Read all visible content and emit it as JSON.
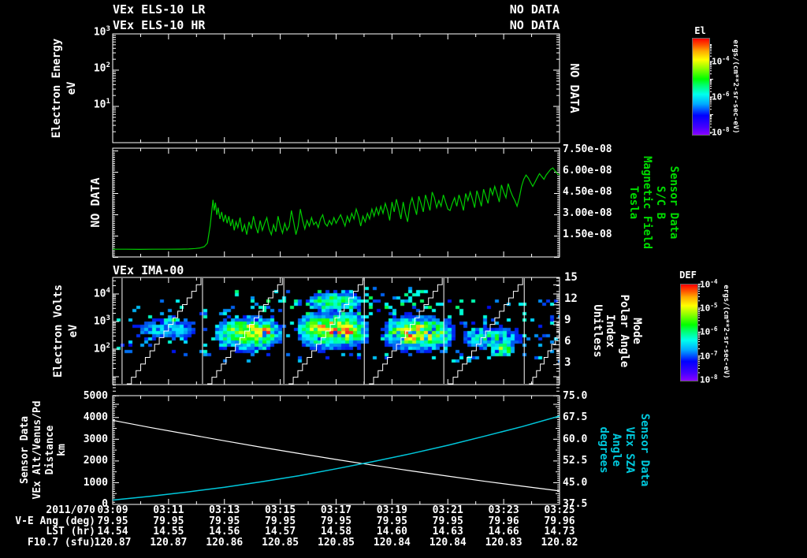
{
  "window": {
    "bg": "#000000",
    "fg": "#ffffff",
    "accent_green": "#00dd00",
    "accent_cyan": "#00c8dc"
  },
  "panel_els": {
    "title_lr": "VEx ELS-10 LR",
    "title_hr": "VEx ELS-10 HR",
    "no_data_lr": "NO DATA",
    "no_data_hr": "NO DATA",
    "no_data_overlay": "NO DATA",
    "ylabel": "Electron Energy",
    "ylabel_unit": "eV",
    "ytick_exps": [
      "3",
      "2",
      "1"
    ],
    "colorbar": {
      "title": "El",
      "tick_exps": [
        "-4",
        "-6",
        "-8"
      ],
      "unit": "ergs/(cm**2-sr-sec-eV)"
    }
  },
  "panel_mag": {
    "no_data": "NO DATA",
    "ytick_labels": [
      "7.50e-08",
      "6.00e-08",
      "4.50e-08",
      "3.00e-08",
      "1.50e-08"
    ],
    "right_labels": [
      "Tesla",
      "Magnetic Field",
      "S/C B",
      "Sensor Data"
    ]
  },
  "panel_ima": {
    "title": "VEx IMA-00",
    "ylabel": "Electron Volts",
    "ylabel_unit": "eV",
    "ytick_exps": [
      "4",
      "3",
      "2"
    ],
    "right_ticks": [
      "15",
      "12",
      "9",
      "6",
      "3"
    ],
    "right_labels": [
      "Unitless",
      "Index",
      "Polar Angle",
      "Mode"
    ],
    "colorbar": {
      "title": "DEF",
      "tick_exps": [
        "-4",
        "-5",
        "-6",
        "-7",
        "-8"
      ],
      "unit": "ergs/(cm**2-sr-sec-eV)"
    }
  },
  "panel_eph": {
    "left_labels": [
      "Sensor Data",
      "VEx Alt/Venus/Pd",
      "Distance",
      "km"
    ],
    "left_ticks": [
      "5000",
      "4000",
      "3000",
      "2000",
      "1000",
      "0"
    ],
    "right_ticks": [
      "75.0",
      "67.5",
      "60.0",
      "52.5",
      "45.0",
      "37.5"
    ],
    "right_labels": [
      "degrees",
      "Angle",
      "VEx SZA",
      "Sensor Data"
    ]
  },
  "table": {
    "row_labels": [
      "2011/070",
      "V-E Ang (deg)",
      "LST (hr)",
      "F10.7 (sfu)"
    ],
    "times": [
      "03:09",
      "03:11",
      "03:13",
      "03:15",
      "03:17",
      "03:19",
      "03:21",
      "03:23",
      "03:25"
    ],
    "ve_ang": [
      "79.95",
      "79.95",
      "79.95",
      "79.95",
      "79.95",
      "79.95",
      "79.95",
      "79.96",
      "79.96"
    ],
    "lst": [
      "14.54",
      "14.55",
      "14.56",
      "14.57",
      "14.58",
      "14.60",
      "14.63",
      "14.66",
      "14.73"
    ],
    "f107": [
      "120.87",
      "120.87",
      "120.86",
      "120.85",
      "120.85",
      "120.84",
      "120.84",
      "120.83",
      "120.82"
    ]
  },
  "chart_data": [
    {
      "type": "line",
      "name": "S/C B Magnetic Field",
      "units": "Tesla",
      "ylim": [
        0,
        7.5e-08
      ],
      "ytick_values": [
        1.5e-08,
        3e-08,
        4.5e-08,
        6e-08,
        7.5e-08
      ],
      "x_time_range": [
        "03:09",
        "03:25"
      ],
      "color": "#00cc00",
      "value_scale": 1e-09,
      "points": [
        [
          0,
          5.7
        ],
        [
          0.03,
          5.7
        ],
        [
          0.06,
          5.6
        ],
        [
          0.09,
          5.7
        ],
        [
          0.12,
          5.7
        ],
        [
          0.15,
          5.8
        ],
        [
          0.17,
          5.9
        ],
        [
          0.185,
          6.2
        ],
        [
          0.195,
          6.6
        ],
        [
          0.205,
          7.5
        ],
        [
          0.212,
          10
        ],
        [
          0.218,
          22
        ],
        [
          0.2225,
          35
        ],
        [
          0.2245,
          40.5
        ],
        [
          0.227,
          33
        ],
        [
          0.23,
          38.5
        ],
        [
          0.233,
          30
        ],
        [
          0.236,
          35
        ],
        [
          0.24,
          27
        ],
        [
          0.244,
          32
        ],
        [
          0.248,
          25
        ],
        [
          0.252,
          30
        ],
        [
          0.256,
          24
        ],
        [
          0.26,
          29
        ],
        [
          0.264,
          22
        ],
        [
          0.268,
          27
        ],
        [
          0.272,
          19
        ],
        [
          0.276,
          25
        ],
        [
          0.28,
          21
        ],
        [
          0.285,
          28
        ],
        [
          0.29,
          18
        ],
        [
          0.295,
          23
        ],
        [
          0.3,
          16
        ],
        [
          0.305,
          25
        ],
        [
          0.31,
          20
        ],
        [
          0.315,
          29
        ],
        [
          0.32,
          22
        ],
        [
          0.325,
          17
        ],
        [
          0.33,
          26
        ],
        [
          0.335,
          19
        ],
        [
          0.34,
          24
        ],
        [
          0.345,
          28
        ],
        [
          0.35,
          20
        ],
        [
          0.355,
          16
        ],
        [
          0.36,
          23
        ],
        [
          0.365,
          18
        ],
        [
          0.37,
          29
        ],
        [
          0.375,
          22
        ],
        [
          0.38,
          17
        ],
        [
          0.385,
          24
        ],
        [
          0.39,
          19
        ],
        [
          0.395,
          22
        ],
        [
          0.4,
          33
        ],
        [
          0.405,
          25
        ],
        [
          0.41,
          16
        ],
        [
          0.415,
          22
        ],
        [
          0.42,
          34
        ],
        [
          0.425,
          26
        ],
        [
          0.43,
          20
        ],
        [
          0.435,
          26
        ],
        [
          0.44,
          22
        ],
        [
          0.445,
          28
        ],
        [
          0.45,
          23
        ],
        [
          0.455,
          25
        ],
        [
          0.46,
          21
        ],
        [
          0.465,
          27
        ],
        [
          0.47,
          30
        ],
        [
          0.475,
          24
        ],
        [
          0.48,
          22
        ],
        [
          0.485,
          26
        ],
        [
          0.49,
          23
        ],
        [
          0.495,
          28
        ],
        [
          0.5,
          24
        ],
        [
          0.51,
          30
        ],
        [
          0.515,
          26
        ],
        [
          0.52,
          22
        ],
        [
          0.525,
          29
        ],
        [
          0.53,
          25
        ],
        [
          0.535,
          31
        ],
        [
          0.54,
          27
        ],
        [
          0.545,
          34
        ],
        [
          0.55,
          29
        ],
        [
          0.555,
          22
        ],
        [
          0.56,
          29
        ],
        [
          0.565,
          25
        ],
        [
          0.57,
          31
        ],
        [
          0.575,
          27
        ],
        [
          0.58,
          34
        ],
        [
          0.585,
          29
        ],
        [
          0.59,
          35
        ],
        [
          0.595,
          30
        ],
        [
          0.6,
          36
        ],
        [
          0.605,
          31
        ],
        [
          0.61,
          38
        ],
        [
          0.615,
          33
        ],
        [
          0.62,
          26
        ],
        [
          0.625,
          39
        ],
        [
          0.63,
          32
        ],
        [
          0.635,
          41
        ],
        [
          0.64,
          34
        ],
        [
          0.645,
          27
        ],
        [
          0.65,
          39
        ],
        [
          0.655,
          31
        ],
        [
          0.66,
          25
        ],
        [
          0.665,
          37
        ],
        [
          0.67,
          42
        ],
        [
          0.675,
          36
        ],
        [
          0.68,
          30
        ],
        [
          0.685,
          43
        ],
        [
          0.69,
          38
        ],
        [
          0.695,
          32
        ],
        [
          0.7,
          44
        ],
        [
          0.705,
          39
        ],
        [
          0.71,
          33
        ],
        [
          0.715,
          46
        ],
        [
          0.72,
          42
        ],
        [
          0.725,
          35
        ],
        [
          0.73,
          40
        ],
        [
          0.735,
          36
        ],
        [
          0.74,
          44
        ],
        [
          0.745,
          39
        ],
        [
          0.75,
          34
        ],
        [
          0.755,
          33
        ],
        [
          0.76,
          38
        ],
        [
          0.765,
          42
        ],
        [
          0.77,
          36
        ],
        [
          0.775,
          44
        ],
        [
          0.78,
          39
        ],
        [
          0.785,
          33
        ],
        [
          0.79,
          45
        ],
        [
          0.795,
          40
        ],
        [
          0.8,
          46
        ],
        [
          0.805,
          41
        ],
        [
          0.81,
          35
        ],
        [
          0.815,
          47
        ],
        [
          0.82,
          42
        ],
        [
          0.825,
          36
        ],
        [
          0.83,
          48
        ],
        [
          0.835,
          43
        ],
        [
          0.84,
          38
        ],
        [
          0.845,
          49
        ],
        [
          0.85,
          44
        ],
        [
          0.855,
          50
        ],
        [
          0.86,
          45
        ],
        [
          0.865,
          39
        ],
        [
          0.87,
          51
        ],
        [
          0.875,
          46
        ],
        [
          0.88,
          42
        ],
        [
          0.885,
          52
        ],
        [
          0.89,
          47
        ],
        [
          0.895,
          43
        ],
        [
          0.9,
          40
        ],
        [
          0.905,
          36
        ],
        [
          0.91,
          42
        ],
        [
          0.915,
          50
        ],
        [
          0.92,
          55
        ],
        [
          0.925,
          58
        ],
        [
          0.93,
          56
        ],
        [
          0.935,
          53
        ],
        [
          0.94,
          50
        ],
        [
          0.945,
          53
        ],
        [
          0.95,
          56
        ],
        [
          0.955,
          59
        ],
        [
          0.96,
          57
        ],
        [
          0.965,
          55
        ],
        [
          0.97,
          58
        ],
        [
          0.975,
          60
        ],
        [
          0.98,
          62
        ],
        [
          0.985,
          63
        ],
        [
          0.99,
          61
        ],
        [
          0.995,
          59
        ],
        [
          1,
          58
        ]
      ]
    },
    {
      "type": "heatmap",
      "name": "VEx IMA-00 energy-time spectrogram",
      "ylabel": "Electron Volts (eV)",
      "ylog_range_exp": [
        0.75,
        4.6
      ],
      "colorbar_range_exp": [
        -8,
        -4
      ],
      "x_time_range": [
        "03:09",
        "03:25"
      ],
      "cycle_boundaries_frac": [
        0.021,
        0.201,
        0.383,
        0.563,
        0.741,
        0.921
      ],
      "staircase_steps": 16,
      "bursts": [
        {
          "x0": 0.219,
          "x1": 0.383,
          "logE": 2.6,
          "spread": 0.5,
          "peak": 0.8
        },
        {
          "x0": 0.318,
          "x1": 0.362,
          "logE": 2.62,
          "spread": 0.3,
          "peak": 1.0
        },
        {
          "x0": 0.4,
          "x1": 0.577,
          "logE": 2.7,
          "spread": 0.55,
          "peak": 0.85
        },
        {
          "x0": 0.42,
          "x1": 0.56,
          "logE": 3.75,
          "spread": 0.3,
          "peak": 0.55
        },
        {
          "x0": 0.48,
          "x1": 0.555,
          "logE": 2.7,
          "spread": 0.3,
          "peak": 1.0
        },
        {
          "x0": 0.594,
          "x1": 0.765,
          "logE": 2.6,
          "spread": 0.5,
          "peak": 0.85
        },
        {
          "x0": 0.63,
          "x1": 0.7,
          "logE": 2.55,
          "spread": 0.3,
          "peak": 0.98
        },
        {
          "x0": 0.77,
          "x1": 0.92,
          "logE": 2.4,
          "spread": 0.4,
          "peak": 0.45
        },
        {
          "x0": 0.835,
          "x1": 0.9,
          "logE": 2.0,
          "spread": 0.25,
          "peak": 0.62
        },
        {
          "x0": 0.105,
          "x1": 0.148,
          "logE": 3.05,
          "spread": 0.13,
          "peak": 0.6
        },
        {
          "x0": 0.02,
          "x1": 0.21,
          "logE": 2.7,
          "spread": 0.4,
          "peak": 0.3
        }
      ],
      "speckles": [
        {
          "x0": 0,
          "x1": 1,
          "e0": 1.6,
          "e1": 3.9,
          "v0": 0.12,
          "v1": 0.4,
          "count": 260
        },
        {
          "x0": 0.25,
          "x1": 0.78,
          "e0": 3.3,
          "e1": 4.25,
          "v0": 0.15,
          "v1": 0.5,
          "count": 80
        }
      ]
    },
    {
      "type": "line",
      "name": "VEx Alt/Venus/Pd Distance",
      "units": "km",
      "ylim": [
        0,
        5000
      ],
      "color": "#ffffff",
      "points": [
        [
          0,
          3870
        ],
        [
          0.083,
          3546
        ],
        [
          0.167,
          3232
        ],
        [
          0.25,
          2927
        ],
        [
          0.333,
          2631
        ],
        [
          0.417,
          2345
        ],
        [
          0.5,
          2070
        ],
        [
          0.583,
          1804
        ],
        [
          0.667,
          1547
        ],
        [
          0.75,
          1301
        ],
        [
          0.833,
          1064
        ],
        [
          0.917,
          837
        ],
        [
          1,
          620
        ]
      ]
    },
    {
      "type": "line",
      "name": "VEx SZA Angle",
      "units": "degrees",
      "ylim": [
        37.5,
        75.0
      ],
      "color": "#00c8dc",
      "points": [
        [
          0,
          39.0
        ],
        [
          0.083,
          40.3
        ],
        [
          0.167,
          41.8
        ],
        [
          0.25,
          43.4
        ],
        [
          0.333,
          45.3
        ],
        [
          0.417,
          47.4
        ],
        [
          0.5,
          49.8
        ],
        [
          0.583,
          52.3
        ],
        [
          0.667,
          55.0
        ],
        [
          0.75,
          57.9
        ],
        [
          0.833,
          61.1
        ],
        [
          0.917,
          64.4
        ],
        [
          1,
          68.0
        ]
      ]
    }
  ]
}
